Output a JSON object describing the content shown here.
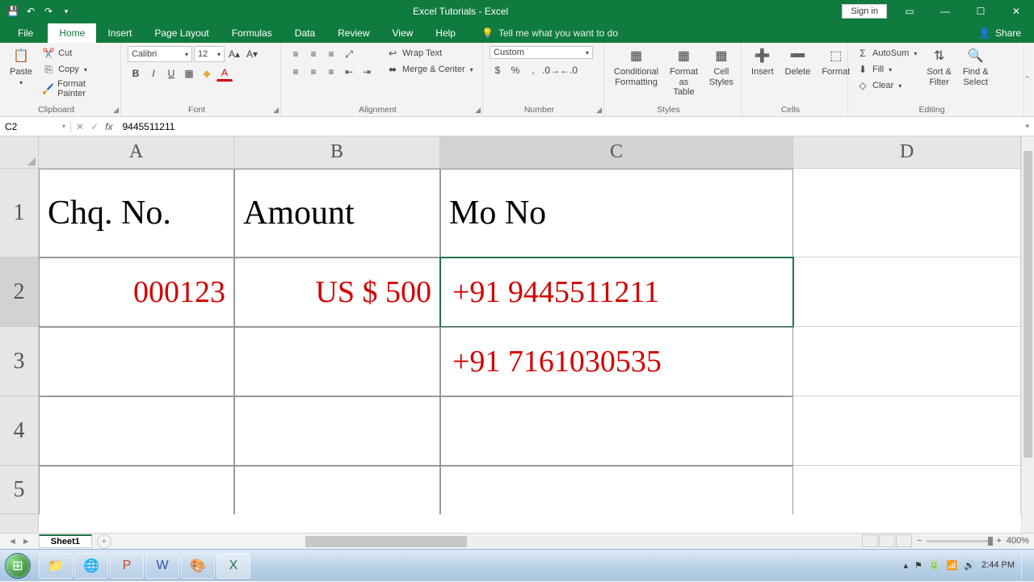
{
  "title": "Excel Tutorials  -  Excel",
  "signin": "Sign in",
  "tabs": {
    "file": "File",
    "home": "Home",
    "insert": "Insert",
    "pagelayout": "Page Layout",
    "formulas": "Formulas",
    "data": "Data",
    "review": "Review",
    "view": "View",
    "help": "Help",
    "tellme": "Tell me what you want to do",
    "share": "Share"
  },
  "ribbon": {
    "clipboard": {
      "paste": "Paste",
      "cut": "Cut",
      "copy": "Copy",
      "painter": "Format Painter",
      "label": "Clipboard"
    },
    "font": {
      "name": "Calibri",
      "size": "12",
      "label": "Font"
    },
    "alignment": {
      "wrap": "Wrap Text",
      "merge": "Merge & Center",
      "label": "Alignment"
    },
    "number": {
      "format": "Custom",
      "label": "Number"
    },
    "styles": {
      "cond": "Conditional\nFormatting",
      "table": "Format as\nTable",
      "cell": "Cell\nStyles",
      "label": "Styles"
    },
    "cells": {
      "insert": "Insert",
      "delete": "Delete",
      "format": "Format",
      "label": "Cells"
    },
    "editing": {
      "autosum": "AutoSum",
      "fill": "Fill",
      "clear": "Clear",
      "sort": "Sort &\nFilter",
      "find": "Find &\nSelect",
      "label": "Editing"
    }
  },
  "namebox": "C2",
  "formula": "9445511211",
  "cols": {
    "A": "A",
    "B": "B",
    "C": "C",
    "D": "D"
  },
  "rows": {
    "r1": "1",
    "r2": "2",
    "r3": "3",
    "r4": "4",
    "r5": "5"
  },
  "grid": {
    "A1": "Chq. No.",
    "B1": "Amount",
    "C1": "Mo No",
    "A2": "000123",
    "B2": "US $ 500",
    "C2": "+91 9445511211",
    "C3": "+91 7161030535"
  },
  "sheet_tab": "Sheet1",
  "zoom": "400%",
  "clock": {
    "time": "2:44 PM"
  }
}
